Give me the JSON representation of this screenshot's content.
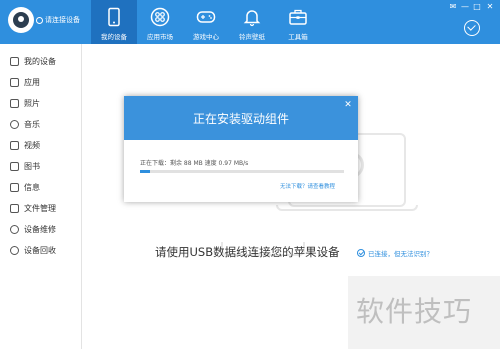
{
  "header": {
    "connection_label": "请连接设备",
    "tabs": [
      {
        "label": "我的设备",
        "icon": "phone-icon",
        "active": true
      },
      {
        "label": "应用市场",
        "icon": "apps-icon",
        "active": false
      },
      {
        "label": "游戏中心",
        "icon": "gamepad-icon",
        "active": false
      },
      {
        "label": "铃声壁纸",
        "icon": "bell-icon",
        "active": false
      },
      {
        "label": "工具箱",
        "icon": "toolbox-icon",
        "active": false
      }
    ],
    "window_controls": [
      "✉",
      "—",
      "□",
      "✕"
    ]
  },
  "sidebar": {
    "items": [
      {
        "label": "我的设备",
        "icon": "device-icon"
      },
      {
        "label": "应用",
        "icon": "app-icon"
      },
      {
        "label": "照片",
        "icon": "photo-icon"
      },
      {
        "label": "音乐",
        "icon": "music-icon"
      },
      {
        "label": "视频",
        "icon": "video-icon"
      },
      {
        "label": "图书",
        "icon": "book-icon"
      },
      {
        "label": "信息",
        "icon": "message-icon"
      },
      {
        "label": "文件管理",
        "icon": "folder-icon"
      },
      {
        "label": "设备维修",
        "icon": "repair-icon"
      },
      {
        "label": "设备回收",
        "icon": "recycle-icon"
      }
    ]
  },
  "main": {
    "instruction": "请使用USB数据线连接您的苹果设备",
    "status_text": "已连接，但无法识别？"
  },
  "dialog": {
    "title": "正在安装驱动组件",
    "close": "✕",
    "progress_text": "正在下载：剩余 88 MB 速度 0.97 MB/s",
    "progress_fraction": 0.05,
    "help_links": "无法下载？请查看教程"
  },
  "watermark": "软件技巧",
  "colors": {
    "topbar": "#2f8fde",
    "active_tab": "#1f71bf",
    "dialog_header": "#3b92dc",
    "progress": "#2f8fde"
  }
}
